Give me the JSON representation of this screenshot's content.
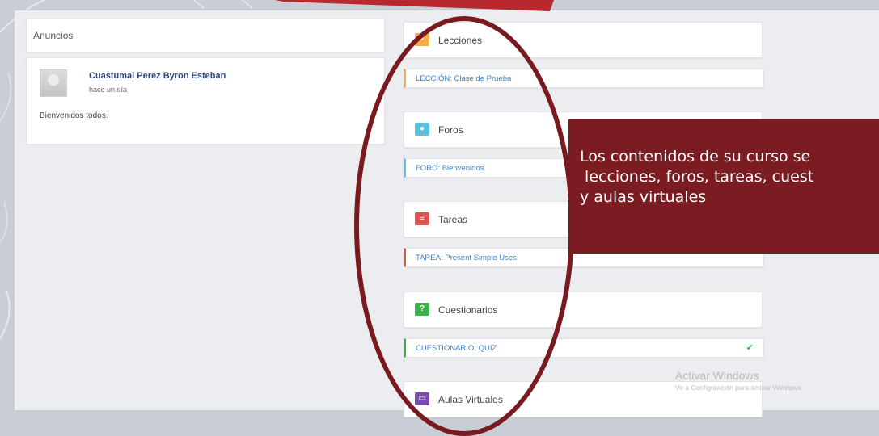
{
  "announcements": {
    "title": "Anuncios",
    "author": "Cuastumal Perez Byron Esteban",
    "time": "hace un día",
    "message": "Bienvenidos todos."
  },
  "sections": [
    {
      "title": "Lecciones",
      "icon": "briefcase-icon",
      "color": "#f0ad4e",
      "item": "LECCIÓN: Clase de Prueba"
    },
    {
      "title": "Foros",
      "icon": "chat-icon",
      "color": "#5bc0de",
      "item": "FORO: Bienvenidos"
    },
    {
      "title": "Tareas",
      "icon": "list-icon",
      "color": "#d9534f",
      "item": "TAREA: Present Simple Uses"
    },
    {
      "title": "Cuestionarios",
      "icon": "question-icon",
      "color": "#3cb04a",
      "item": "CUESTIONARIO: QUIZ",
      "status": "check-icon"
    },
    {
      "title": "Aulas Virtuales",
      "icon": "monitor-icon",
      "color": "#7a4ca8"
    }
  ],
  "callout": {
    "text": "Los contenidos de su curso se\n lecciones, foros, tareas, cuest\ny aulas virtuales"
  },
  "watermark": {
    "line1": "Activar Windows",
    "line2": "Ve a Configuración para activar Windows."
  }
}
